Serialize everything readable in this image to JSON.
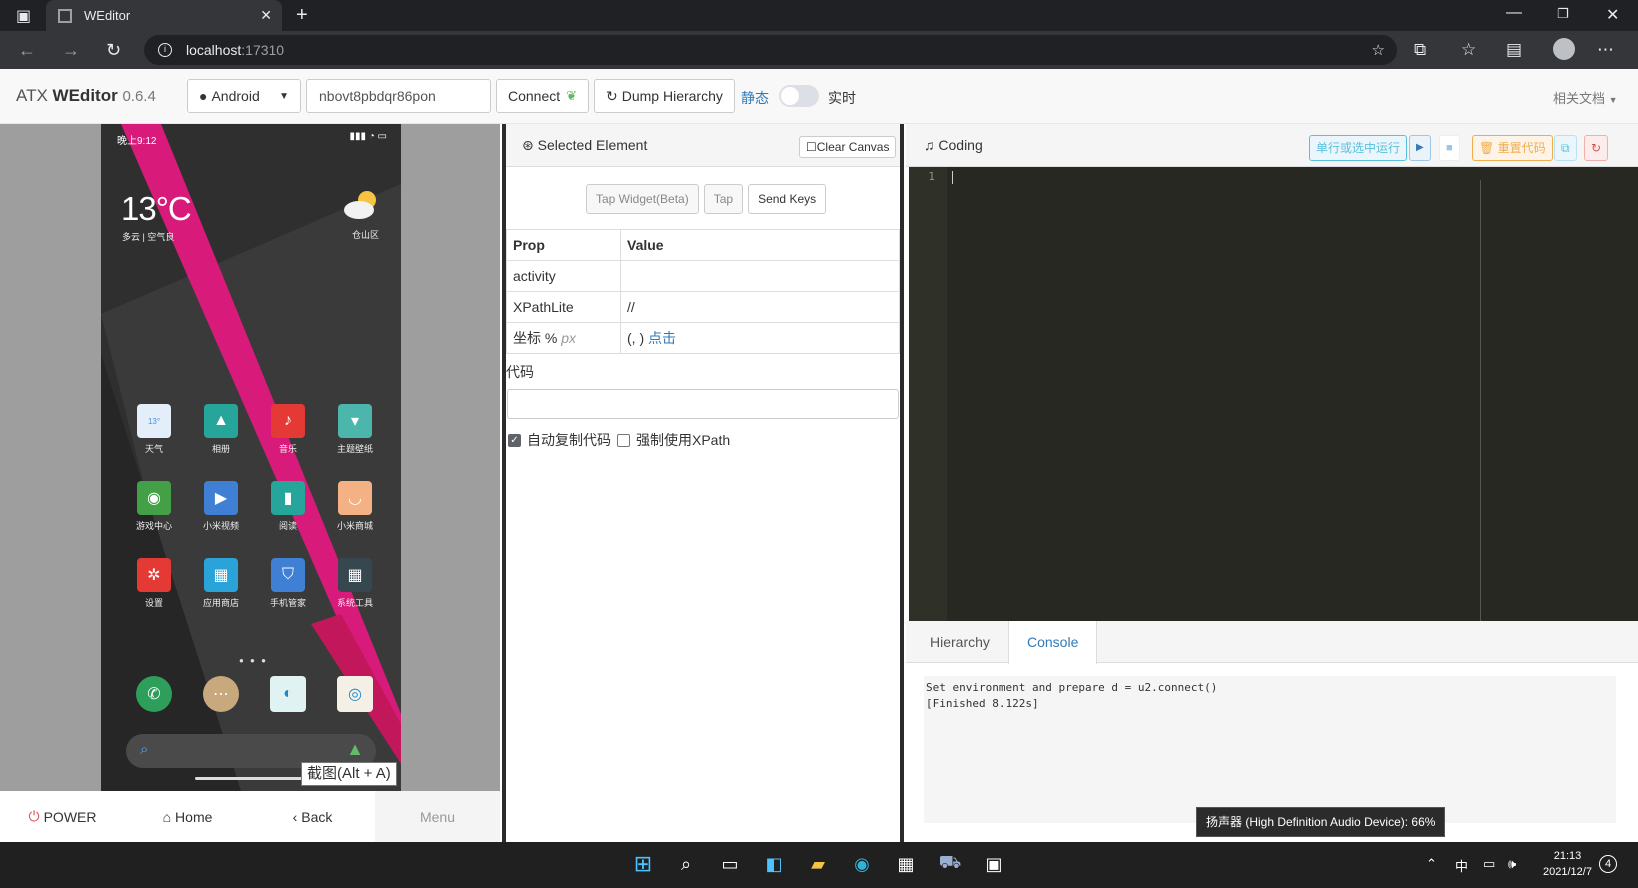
{
  "browser": {
    "tab_title": "WEditor",
    "url_host": "localhost",
    "url_port": ":17310"
  },
  "navbar": {
    "brand_prefix": "ATX",
    "brand_name": "WEditor",
    "version": "0.6.4",
    "platform_select": "Android",
    "serial_value": "nbovt8pbdqr86pon",
    "connect_label": "Connect",
    "dump_label": "Dump Hierarchy",
    "static_label": "静态",
    "live_label": "实时",
    "docs_label": "相关文档"
  },
  "phone": {
    "status_time": "晚上9:12",
    "clock": "13°C",
    "weather_sub": "多云 | 空气良",
    "city": "仓山区",
    "apps": [
      {
        "label": "天气",
        "color": "#e3eef8"
      },
      {
        "label": "相册",
        "color": "#26a69a"
      },
      {
        "label": "音乐",
        "color": "#e53935"
      },
      {
        "label": "主题壁纸",
        "color": "#4db6ac"
      },
      {
        "label": "游戏中心",
        "color": "#43a047"
      },
      {
        "label": "小米视频",
        "color": "#3f7fd4"
      },
      {
        "label": "阅读",
        "color": "#26a69a"
      },
      {
        "label": "小米商城",
        "color": "#f4b183"
      },
      {
        "label": "设置",
        "color": "#e53935"
      },
      {
        "label": "应用商店",
        "color": "#29a3d8"
      },
      {
        "label": "手机管家",
        "color": "#3f7fd4"
      },
      {
        "label": "系统工具",
        "color": "#37474f"
      }
    ],
    "dock_colors": [
      "#2e9e5b",
      "#c8a97e",
      "#e0f2f1",
      "#f5f0e6"
    ]
  },
  "device_buttons": {
    "power": "POWER",
    "home": "Home",
    "back": "Back",
    "menu": "Menu"
  },
  "screenshot_tooltip": "截图(Alt + A)",
  "selected": {
    "title": "Selected Element",
    "clear_canvas": "Clear Canvas",
    "tap_widget": "Tap Widget(Beta)",
    "tap": "Tap",
    "send_keys": "Send Keys",
    "col_prop": "Prop",
    "col_value": "Value",
    "rows": [
      {
        "prop": "activity",
        "value": ""
      },
      {
        "prop": "XPathLite",
        "value": "//"
      }
    ],
    "coord_label": "坐标 %",
    "coord_px": "px",
    "coord_value": "(, )",
    "coord_click": "点击",
    "code_label": "代码",
    "auto_copy": "自动复制代码",
    "force_xpath": "强制使用XPath"
  },
  "coding": {
    "title": "Coding",
    "run_label": "单行或选中运行",
    "reset_label": "重置代码",
    "line_number": "1",
    "tab_hierarchy": "Hierarchy",
    "tab_console": "Console",
    "console_lines": [
      "Set environment and prepare d = u2.connect()",
      "[Finished 8.122s]"
    ]
  },
  "volume_tip": "扬声器 (High Definition Audio Device): 66%",
  "taskbar": {
    "ime": "中",
    "time": "21:13",
    "date": "2021/12/7",
    "notifications": "4"
  }
}
